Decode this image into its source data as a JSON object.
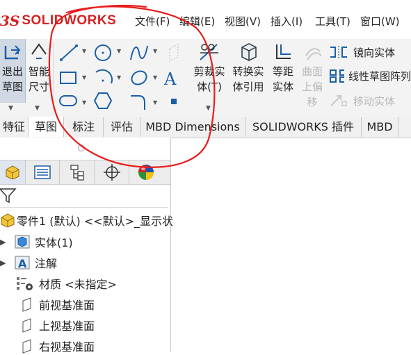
{
  "app": {
    "logo_ds": "3S",
    "logo_name": "SOLIDWORKS",
    "brand_color": "#d62020"
  },
  "menu": {
    "items": [
      {
        "label": "文件(F)"
      },
      {
        "label": "编辑(E)"
      },
      {
        "label": "视图(V)"
      },
      {
        "label": "插入(I)"
      },
      {
        "label": "工具(T)"
      },
      {
        "label": "窗口(W)"
      }
    ]
  },
  "ribbon": {
    "exit_sketch": {
      "line1": "退出",
      "line2": "草图"
    },
    "smart_dim": {
      "line1": "智能",
      "line2": "尺寸"
    },
    "trim": {
      "line1": "剪裁实",
      "line2": "体(T)"
    },
    "convert": {
      "line1": "转换实",
      "line2": "体引用"
    },
    "offset": {
      "line1": "等距",
      "line2": "实体"
    },
    "surface_offset": {
      "line1": "曲面",
      "line2": "上偏",
      "line3": "移"
    },
    "mirror": {
      "label": "镜向实体"
    },
    "linear_pattern": {
      "label": "线性草图阵列"
    },
    "move": {
      "label": "移动实体"
    }
  },
  "tabs": [
    {
      "label": "特征"
    },
    {
      "label": "草图"
    },
    {
      "label": "标注"
    },
    {
      "label": "评估"
    },
    {
      "label": "MBD Dimensions"
    },
    {
      "label": "SOLIDWORKS 插件"
    },
    {
      "label": "MBD"
    }
  ],
  "tree": {
    "root": "零件1 (默认) <<默认>_显示状",
    "items": [
      {
        "label": "实体(1)"
      },
      {
        "label": "注解"
      },
      {
        "label": "材质 <未指定>"
      },
      {
        "label": "前视基准面"
      },
      {
        "label": "上视基准面"
      },
      {
        "label": "右视基准面"
      }
    ]
  },
  "colors": {
    "annotation_circle": "#e81c1c",
    "icon_blue": "#1a5fa8"
  }
}
